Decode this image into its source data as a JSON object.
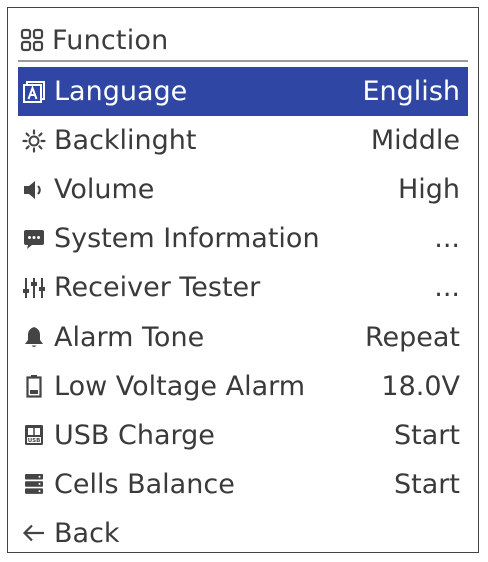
{
  "header": {
    "title": "Function",
    "icon": "grid-icon"
  },
  "colors": {
    "selected_bg": "#2f46a4",
    "text": "#3a3a3a",
    "icon": "#444444"
  },
  "menu": [
    {
      "label": "Language",
      "value": "English",
      "icon": "language-icon",
      "selected": true
    },
    {
      "label": "Backlinght",
      "value": "Middle",
      "icon": "sun-icon"
    },
    {
      "label": "Volume",
      "value": "High",
      "icon": "speaker-icon"
    },
    {
      "label": "System Information",
      "value": "...",
      "icon": "chat-icon"
    },
    {
      "label": "Receiver Tester",
      "value": "...",
      "icon": "sliders-icon"
    },
    {
      "label": "Alarm Tone",
      "value": "Repeat",
      "icon": "bell-icon"
    },
    {
      "label": "Low Voltage Alarm",
      "value": "18.0V",
      "icon": "battery-icon"
    },
    {
      "label": "USB Charge",
      "value": "Start",
      "icon": "usb-icon"
    },
    {
      "label": "Cells Balance",
      "value": "Start",
      "icon": "stack-icon"
    },
    {
      "label": "Back",
      "value": "",
      "icon": "back-arrow-icon"
    }
  ]
}
